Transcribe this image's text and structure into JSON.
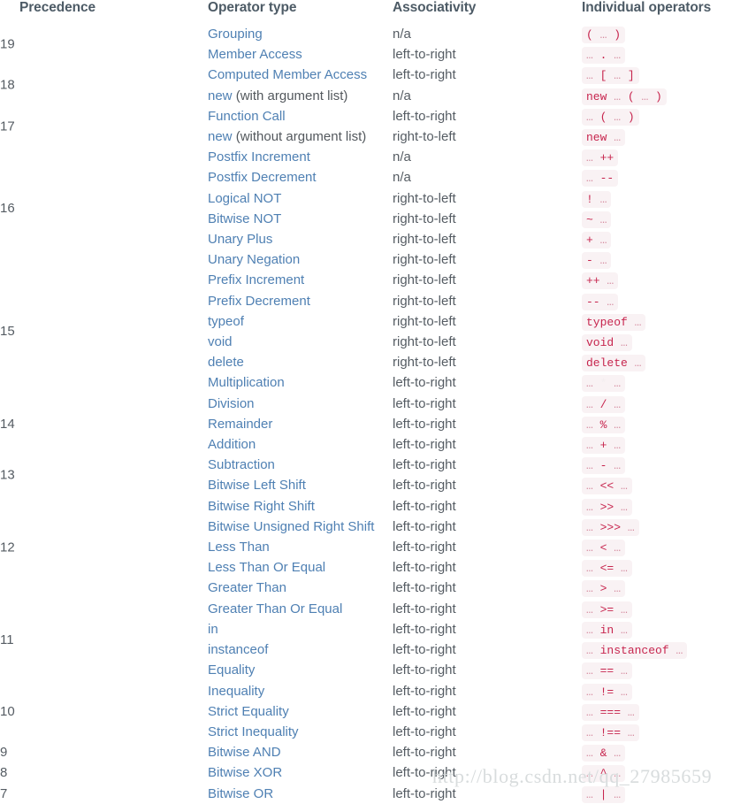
{
  "table": {
    "headers": {
      "precedence": "Precedence",
      "operator_type": "Operator type",
      "associativity": "Associativity",
      "individual_operators": "Individual operators"
    },
    "rows": [
      {
        "precedence": "19",
        "type_link": "Grouping",
        "type_plain": "",
        "associativity": "n/a",
        "operator": "( … )"
      },
      {
        "precedence": "",
        "type_link": "Member Access",
        "type_plain": "",
        "associativity": "left-to-right",
        "operator": "… . …"
      },
      {
        "precedence": "18",
        "type_link": "Computed Member Access",
        "type_plain": "",
        "associativity": "left-to-right",
        "operator": "… [ … ]"
      },
      {
        "precedence": "",
        "type_link": "new",
        "type_plain": " (with argument list)",
        "associativity": "n/a",
        "operator": "new … ( … )"
      },
      {
        "precedence": "17",
        "type_link": "Function Call",
        "type_plain": "",
        "associativity": "left-to-right",
        "operator": "… ( … )"
      },
      {
        "precedence": "",
        "type_link": "new",
        "type_plain": " (without argument list)",
        "associativity": "right-to-left",
        "operator": "new …"
      },
      {
        "precedence": "16",
        "type_link": "Postfix Increment",
        "type_plain": "",
        "associativity": "n/a",
        "operator": "… ++"
      },
      {
        "precedence": "",
        "type_link": "Postfix Decrement",
        "type_plain": "",
        "associativity": "n/a",
        "operator": "… --"
      },
      {
        "precedence": "",
        "type_link": "Logical NOT",
        "type_plain": "",
        "associativity": "right-to-left",
        "operator": "! …"
      },
      {
        "precedence": "",
        "type_link": "Bitwise NOT",
        "type_plain": "",
        "associativity": "right-to-left",
        "operator": "~ …"
      },
      {
        "precedence": "",
        "type_link": "Unary Plus",
        "type_plain": "",
        "associativity": "right-to-left",
        "operator": "+ …"
      },
      {
        "precedence": "",
        "type_link": "Unary Negation",
        "type_plain": "",
        "associativity": "right-to-left",
        "operator": "- …"
      },
      {
        "precedence": "15",
        "type_link": "Prefix Increment",
        "type_plain": "",
        "associativity": "right-to-left",
        "operator": "++ …"
      },
      {
        "precedence": "",
        "type_link": "Prefix Decrement",
        "type_plain": "",
        "associativity": "right-to-left",
        "operator": "-- …"
      },
      {
        "precedence": "",
        "type_link": "typeof",
        "type_plain": "",
        "associativity": "right-to-left",
        "operator": "typeof …"
      },
      {
        "precedence": "",
        "type_link": "void",
        "type_plain": "",
        "associativity": "right-to-left",
        "operator": "void …"
      },
      {
        "precedence": "",
        "type_link": "delete",
        "type_plain": "",
        "associativity": "right-to-left",
        "operator": "delete …"
      },
      {
        "precedence": "",
        "type_link": "Multiplication",
        "type_plain": "",
        "associativity": "left-to-right",
        "operator": "… * …"
      },
      {
        "precedence": "14",
        "type_link": "Division",
        "type_plain": "",
        "associativity": "left-to-right",
        "operator": "… / …"
      },
      {
        "precedence": "",
        "type_link": "Remainder",
        "type_plain": "",
        "associativity": "left-to-right",
        "operator": "… % …"
      },
      {
        "precedence": "",
        "type_link": "Addition",
        "type_plain": "",
        "associativity": "left-to-right",
        "operator": "… + …"
      },
      {
        "precedence": "13",
        "type_link": "Subtraction",
        "type_plain": "",
        "associativity": "left-to-right",
        "operator": "… - …"
      },
      {
        "precedence": "",
        "type_link": "Bitwise Left Shift",
        "type_plain": "",
        "associativity": "left-to-right",
        "operator": "… << …"
      },
      {
        "precedence": "12",
        "type_link": "Bitwise Right Shift",
        "type_plain": "",
        "associativity": "left-to-right",
        "operator": "… >> …"
      },
      {
        "precedence": "",
        "type_link": "Bitwise Unsigned Right Shift",
        "type_plain": "",
        "associativity": "left-to-right",
        "operator": "… >>> …"
      },
      {
        "precedence": "",
        "type_link": "Less Than",
        "type_plain": "",
        "associativity": "left-to-right",
        "operator": "… < …"
      },
      {
        "precedence": "",
        "type_link": "Less Than Or Equal",
        "type_plain": "",
        "associativity": "left-to-right",
        "operator": "… <= …"
      },
      {
        "precedence": "",
        "type_link": "Greater Than",
        "type_plain": "",
        "associativity": "left-to-right",
        "operator": "… > …"
      },
      {
        "precedence": "11",
        "type_link": "Greater Than Or Equal",
        "type_plain": "",
        "associativity": "left-to-right",
        "operator": "… >= …"
      },
      {
        "precedence": "",
        "type_link": "in",
        "type_plain": "",
        "associativity": "left-to-right",
        "operator": "… in …"
      },
      {
        "precedence": "",
        "type_link": "instanceof",
        "type_plain": "",
        "associativity": "left-to-right",
        "operator": "… instanceof …"
      },
      {
        "precedence": "",
        "type_link": "Equality",
        "type_plain": "",
        "associativity": "left-to-right",
        "operator": "… == …"
      },
      {
        "precedence": "10",
        "type_link": "Inequality",
        "type_plain": "",
        "associativity": "left-to-right",
        "operator": "… != …"
      },
      {
        "precedence": "",
        "type_link": "Strict Equality",
        "type_plain": "",
        "associativity": "left-to-right",
        "operator": "… === …"
      },
      {
        "precedence": "",
        "type_link": "Strict Inequality",
        "type_plain": "",
        "associativity": "left-to-right",
        "operator": "… !== …"
      },
      {
        "precedence": "9",
        "type_link": "Bitwise AND",
        "type_plain": "",
        "associativity": "left-to-right",
        "operator": "… & …"
      },
      {
        "precedence": "8",
        "type_link": "Bitwise XOR",
        "type_plain": "",
        "associativity": "left-to-right",
        "operator": "… ^ …"
      },
      {
        "precedence": "7",
        "type_link": "Bitwise OR",
        "type_plain": "",
        "associativity": "left-to-right",
        "operator": "… | …"
      }
    ]
  },
  "watermark": {
    "text": "http://blog.csdn.net/qq_27985659"
  },
  "colors": {
    "link": "#4f80b3",
    "header_text": "#4d5b66",
    "body_text": "#53585d",
    "precedence_text": "#7a8289",
    "code_text": "#c7254e",
    "code_background": "#f9f2f4",
    "page_background": "#ffffff",
    "watermark_text": "#d8dcdd"
  }
}
